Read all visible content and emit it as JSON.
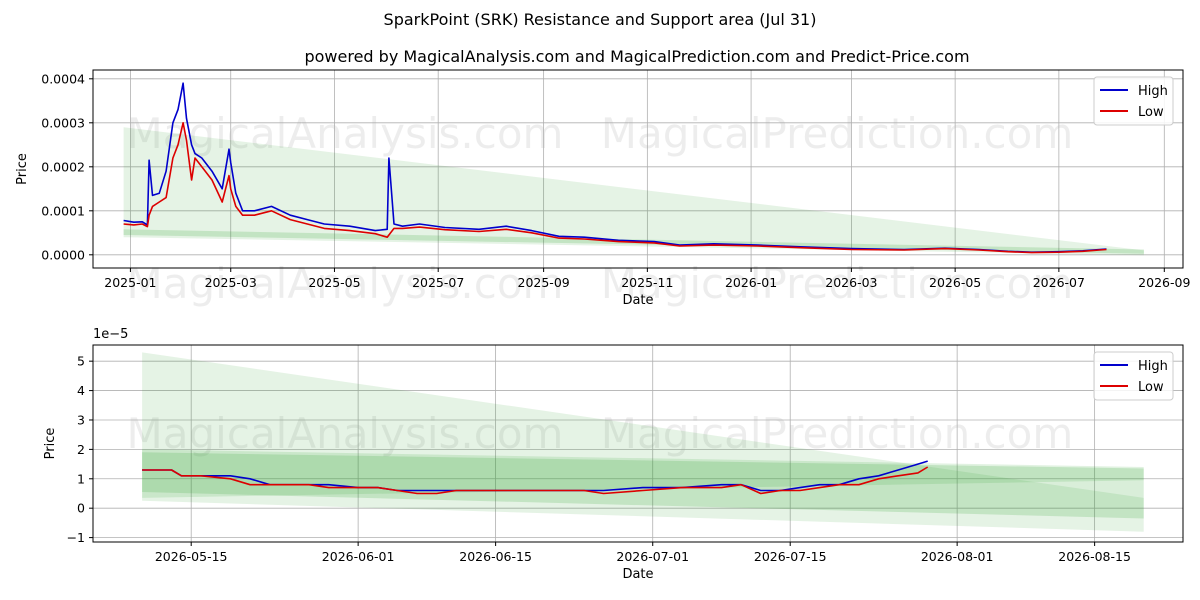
{
  "title": "SparkPoint (SRK) Resistance and Support area (Jul 31)",
  "subtitle": "powered by MagicalAnalysis.com and MagicalPrediction.com and Predict-Price.com",
  "watermarks": [
    "MagicalAnalysis.com",
    "MagicalPrediction.com"
  ],
  "colors": {
    "high": "#0000cc",
    "low": "#dd0000",
    "band": "#2ca02c"
  },
  "chart_data": [
    {
      "type": "line",
      "xlabel": "Date",
      "ylabel": "Price",
      "x_ticks": [
        "2025-01",
        "2025-03",
        "2025-05",
        "2025-07",
        "2025-09",
        "2025-11",
        "2026-01",
        "2026-03",
        "2026-05",
        "2026-07",
        "2026-09"
      ],
      "y_ticks": [
        "0.0000",
        "0.0001",
        "0.0002",
        "0.0003",
        "0.0004"
      ],
      "xlim": [
        "2024-12-10",
        "2026-09-12"
      ],
      "ylim": [
        -3e-05,
        0.00042
      ],
      "grid": true,
      "legend": "top-right",
      "dates": [
        "2024-12-28",
        "2025-01-03",
        "2025-01-08",
        "2025-01-11",
        "2025-01-12",
        "2025-01-14",
        "2025-01-18",
        "2025-01-22",
        "2025-01-26",
        "2025-01-29",
        "2025-02-01",
        "2025-02-03",
        "2025-02-06",
        "2025-02-08",
        "2025-02-12",
        "2025-02-18",
        "2025-02-24",
        "2025-02-28",
        "2025-03-01",
        "2025-03-04",
        "2025-03-08",
        "2025-03-15",
        "2025-03-25",
        "2025-04-05",
        "2025-04-15",
        "2025-04-25",
        "2025-05-10",
        "2025-05-25",
        "2025-06-01",
        "2025-06-02",
        "2025-06-05",
        "2025-06-10",
        "2025-06-20",
        "2025-07-05",
        "2025-07-25",
        "2025-08-10",
        "2025-08-25",
        "2025-09-10",
        "2025-09-25",
        "2025-10-15",
        "2025-11-05",
        "2025-11-20",
        "2025-12-10",
        "2026-01-05",
        "2026-02-01",
        "2026-03-01",
        "2026-04-01",
        "2026-04-25",
        "2026-05-15",
        "2026-06-01",
        "2026-06-15",
        "2026-07-01",
        "2026-07-15",
        "2026-07-25",
        "2026-07-29"
      ],
      "series": [
        {
          "name": "High",
          "values": [
            7.8e-05,
            7.4e-05,
            7.5e-05,
            6.8e-05,
            0.000215,
            0.000135,
            0.00014,
            0.00019,
            0.0003,
            0.00033,
            0.00039,
            0.00031,
            0.00025,
            0.00023,
            0.00022,
            0.00019,
            0.00015,
            0.00024,
            0.00021,
            0.00014,
            0.0001,
            0.0001,
            0.00011,
            9e-05,
            8e-05,
            7e-05,
            6.5e-05,
            5.5e-05,
            5.8e-05,
            0.00022,
            7e-05,
            6.5e-05,
            7e-05,
            6.2e-05,
            5.8e-05,
            6.5e-05,
            5.5e-05,
            4.2e-05,
            4e-05,
            3.3e-05,
            3e-05,
            2.2e-05,
            2.5e-05,
            2.2e-05,
            1.8e-05,
            1.4e-05,
            1.2e-05,
            1.5e-05,
            1.2e-05,
            8e-06,
            6e-06,
            7e-06,
            9e-06,
            1.2e-05,
            1.3e-05
          ]
        },
        {
          "name": "Low",
          "values": [
            7e-05,
            6.8e-05,
            7e-05,
            6.4e-05,
            9e-05,
            0.00011,
            0.00012,
            0.00013,
            0.00022,
            0.00025,
            0.0003,
            0.00026,
            0.00017,
            0.00022,
            0.0002,
            0.00017,
            0.00012,
            0.00018,
            0.00015,
            0.00011,
            9e-05,
            9e-05,
            0.0001,
            8e-05,
            7e-05,
            6e-05,
            5.5e-05,
            4.8e-05,
            4e-05,
            4.5e-05,
            6e-05,
            6e-05,
            6.3e-05,
            5.7e-05,
            5.3e-05,
            5.8e-05,
            5e-05,
            3.8e-05,
            3.6e-05,
            3e-05,
            2.7e-05,
            2e-05,
            2.2e-05,
            2e-05,
            1.6e-05,
            1.2e-05,
            1.1e-05,
            1.4e-05,
            1.1e-05,
            7e-06,
            5e-06,
            6e-06,
            8e-06,
            1.1e-05,
            1.2e-05
          ]
        }
      ]
    },
    {
      "type": "line",
      "xlabel": "Date",
      "ylabel": "Price",
      "offset_text": "1e−5",
      "x_ticks": [
        "2026-05-15",
        "2026-06-01",
        "2026-06-15",
        "2026-07-01",
        "2026-07-15",
        "2026-08-01",
        "2026-08-15"
      ],
      "y_ticks": [
        "−1",
        "0",
        "1",
        "2",
        "3",
        "4",
        "5"
      ],
      "xlim": [
        "2026-05-05",
        "2026-08-24"
      ],
      "ylim": [
        -1.15,
        5.55
      ],
      "grid": true,
      "legend": "top-right",
      "dates": [
        "2026-05-10",
        "2026-05-13",
        "2026-05-14",
        "2026-05-16",
        "2026-05-19",
        "2026-05-21",
        "2026-05-23",
        "2026-05-25",
        "2026-05-27",
        "2026-05-29",
        "2026-06-01",
        "2026-06-03",
        "2026-06-05",
        "2026-06-07",
        "2026-06-09",
        "2026-06-11",
        "2026-06-13",
        "2026-06-15",
        "2026-06-20",
        "2026-06-24",
        "2026-06-26",
        "2026-06-30",
        "2026-07-04",
        "2026-07-08",
        "2026-07-10",
        "2026-07-12",
        "2026-07-14",
        "2026-07-16",
        "2026-07-18",
        "2026-07-20",
        "2026-07-22",
        "2026-07-24",
        "2026-07-26",
        "2026-07-28",
        "2026-07-29"
      ],
      "series": [
        {
          "name": "High",
          "values": [
            1.3,
            1.3,
            1.1,
            1.1,
            1.1,
            1.0,
            0.8,
            0.8,
            0.8,
            0.8,
            0.7,
            0.7,
            0.6,
            0.6,
            0.6,
            0.6,
            0.6,
            0.6,
            0.6,
            0.6,
            0.6,
            0.7,
            0.7,
            0.8,
            0.8,
            0.6,
            0.6,
            0.7,
            0.8,
            0.8,
            1.0,
            1.1,
            1.3,
            1.5,
            1.6
          ]
        },
        {
          "name": "Low",
          "values": [
            1.3,
            1.3,
            1.1,
            1.1,
            1.0,
            0.8,
            0.8,
            0.8,
            0.8,
            0.7,
            0.7,
            0.7,
            0.6,
            0.5,
            0.5,
            0.6,
            0.6,
            0.6,
            0.6,
            0.6,
            0.5,
            0.6,
            0.7,
            0.7,
            0.8,
            0.5,
            0.6,
            0.6,
            0.7,
            0.8,
            0.8,
            1.0,
            1.1,
            1.2,
            1.4
          ]
        }
      ]
    }
  ]
}
